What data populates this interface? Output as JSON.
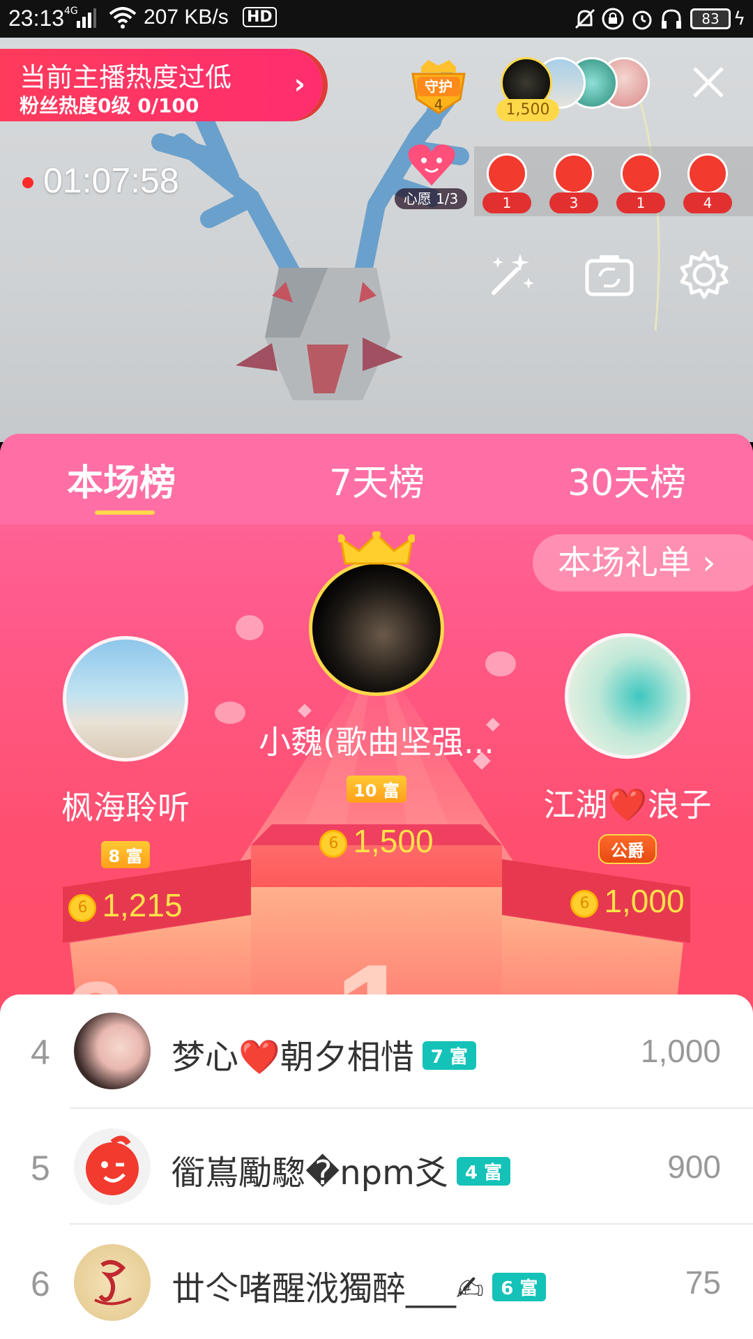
{
  "status_bar": {
    "time": "23:13",
    "network": "4G",
    "speed": "207 KB/s",
    "hd": "HD",
    "battery": "83"
  },
  "live": {
    "heat_title": "当前主播热度过低",
    "heat_sub": "粉丝热度0级 0/100",
    "guard_label": "守护",
    "guard_count": "4",
    "top_contributor_count": "1,500",
    "duration": "01:07:58",
    "wish_label": "心愿 1/3",
    "fan_counts": [
      "1",
      "3",
      "1",
      "4"
    ]
  },
  "rank": {
    "tabs": [
      "本场榜",
      "7天榜",
      "30天榜"
    ],
    "gift_list_label": "本场礼单 ›",
    "first": {
      "name": "小魏(歌曲坚强...",
      "wealth": "10 富",
      "coins": "1,500"
    },
    "second": {
      "name": "枫海聆听",
      "wealth": "8 富",
      "coins": "1,215"
    },
    "third": {
      "name": "江湖❤️浪子",
      "title": "公爵",
      "coins": "1,000"
    },
    "list": [
      {
        "rank": "4",
        "name": "梦心❤️朝夕相惜",
        "badge": "7 富",
        "score": "1,000"
      },
      {
        "rank": "5",
        "name": "衟嶌勵騘�npm爻",
        "badge": "4 富",
        "score": "900"
      },
      {
        "rank": "6",
        "name": "丗仒啫醒浌獨醉___✍",
        "badge": "6 富",
        "score": "75"
      }
    ]
  },
  "colors": {
    "accent_pink": "#ff5a8a",
    "gold": "#ffe14a",
    "teal_badge": "#14c2b8"
  }
}
